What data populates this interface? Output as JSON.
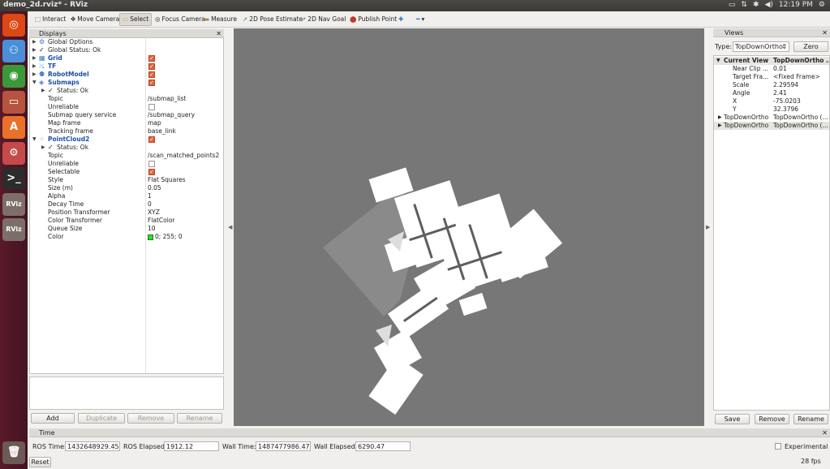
{
  "window": {
    "title": "demo_2d.rviz* - RViz"
  },
  "tray": {
    "clock": "12:19 PM",
    "icons": [
      "display-icon",
      "network-icon",
      "bluetooth-icon",
      "volume-icon",
      "settings-icon"
    ]
  },
  "launcher": {
    "items": [
      {
        "name": "ubuntu-dash-icon",
        "glyph": "◎",
        "color": "#dd4814"
      },
      {
        "name": "pidgin-icon",
        "glyph": "⚇",
        "color": "#4a90d9"
      },
      {
        "name": "chrome-icon",
        "glyph": "◉",
        "color": "#3a9a3a"
      },
      {
        "name": "files-icon",
        "glyph": "▭",
        "color": "#b6543f"
      },
      {
        "name": "software-center-icon",
        "glyph": "A",
        "color": "#e9712a"
      },
      {
        "name": "system-settings-icon",
        "glyph": "⚙",
        "color": "#c54a4a"
      },
      {
        "name": "terminal-icon",
        "glyph": ">_",
        "color": "#2c2c2c"
      },
      {
        "name": "rviz-icon",
        "glyph": "RViz",
        "color": "#7c6f6a"
      },
      {
        "name": "rviz-icon-2",
        "glyph": "RViz",
        "color": "#7c6f6a"
      },
      {
        "name": "trash-icon",
        "glyph": "🗑",
        "color": "#6b5a55"
      }
    ]
  },
  "toolbar": {
    "interact": "Interact",
    "move_camera": "Move Camera",
    "select": "Select",
    "focus_camera": "Focus Camera",
    "measure": "Measure",
    "pose_estimate": "2D Pose Estimate",
    "nav_goal": "2D Nav Goal",
    "publish_point": "Publish Point"
  },
  "displays": {
    "title": "Displays",
    "global_options": "Global Options",
    "global_status": "Global Status: Ok",
    "grid": "Grid",
    "tf": "TF",
    "robot_model": "RobotModel",
    "submaps": {
      "name": "Submaps",
      "status": "Status: Ok",
      "props": [
        {
          "key": "Topic",
          "value": "/submap_list"
        },
        {
          "key": "Unreliable",
          "value": ""
        },
        {
          "key": "Submap query service",
          "value": "/submap_query"
        },
        {
          "key": "Map frame",
          "value": "map"
        },
        {
          "key": "Tracking frame",
          "value": "base_link"
        }
      ]
    },
    "pointcloud": {
      "name": "PointCloud2",
      "status": "Status: Ok",
      "props": [
        {
          "key": "Topic",
          "value": "/scan_matched_points2"
        },
        {
          "key": "Unreliable",
          "value": ""
        },
        {
          "key": "Selectable",
          "value": ""
        },
        {
          "key": "Style",
          "value": "Flat Squares"
        },
        {
          "key": "Size (m)",
          "value": "0.05"
        },
        {
          "key": "Alpha",
          "value": "1"
        },
        {
          "key": "Decay Time",
          "value": "0"
        },
        {
          "key": "Position Transformer",
          "value": "XYZ"
        },
        {
          "key": "Color Transformer",
          "value": "FlatColor"
        },
        {
          "key": "Queue Size",
          "value": "10"
        },
        {
          "key": "Color",
          "value": "0; 255; 0"
        }
      ]
    },
    "buttons": {
      "add": "Add",
      "duplicate": "Duplicate",
      "remove": "Remove",
      "rename": "Rename"
    }
  },
  "views": {
    "title": "Views",
    "type_label": "Type:",
    "type_value": "TopDownOrtho",
    "zero": "Zero",
    "current_view": {
      "key": "Current View",
      "value": "TopDownOrtho ..."
    },
    "props": [
      {
        "key": "Near Clip ...",
        "value": "0.01"
      },
      {
        "key": "Target Fra...",
        "value": "<Fixed Frame>"
      },
      {
        "key": "Scale",
        "value": "2.29594"
      },
      {
        "key": "Angle",
        "value": "2.41"
      },
      {
        "key": "X",
        "value": "-75.0203"
      },
      {
        "key": "Y",
        "value": "32.3796"
      }
    ],
    "saved": [
      {
        "key": "TopDownOrtho",
        "value": "TopDownOrtho (..."
      },
      {
        "key": "TopDownOrtho",
        "value": "TopDownOrtho (..."
      }
    ],
    "buttons": {
      "save": "Save",
      "remove": "Remove",
      "rename": "Rename"
    }
  },
  "time": {
    "title": "Time",
    "ros_time_label": "ROS Time:",
    "ros_time": "1432648929.45",
    "ros_elapsed_label": "ROS Elapsed:",
    "ros_elapsed": "1912.12",
    "wall_time_label": "Wall Time:",
    "wall_time": "1487477986.47",
    "wall_elapsed_label": "Wall Elapsed:",
    "wall_elapsed": "6290.47",
    "experimental": "Experimental",
    "reset": "Reset",
    "fps": "28 fps"
  },
  "colors": {
    "viewport_bg": "#777777",
    "map_points": "#ffffff",
    "checkbox_on": "#e0643a",
    "display_name": "#1a4fa8"
  }
}
